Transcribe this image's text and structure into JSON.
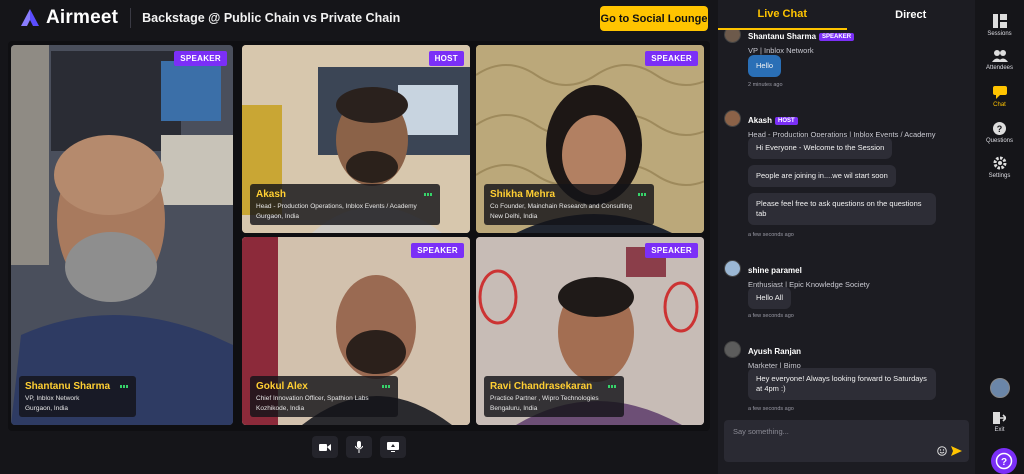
{
  "app": {
    "logo_text": "Airmeet",
    "event_title": "Backstage @ Public Chain vs Private Chain",
    "lounge_button": "Go to Social Lounge"
  },
  "stage": {
    "tiles": [
      {
        "id": "shantanu",
        "badge": "SPEAKER",
        "name": "Shantanu Sharma",
        "role": "VP, Inblox Network",
        "location": "Gurgaon, India",
        "bg": "#3a4258"
      },
      {
        "id": "akash",
        "badge": "HOST",
        "name": "Akash",
        "role": "Head - Production Operations, Inblox Events / Academy",
        "location": "Gurgaon, India",
        "bg": "#c9b59a"
      },
      {
        "id": "shikha",
        "badge": "SPEAKER",
        "name": "Shikha Mehra",
        "role": "Co Founder, Mainchain Research and Consulting",
        "location": "New Delhi, India",
        "bg": "#b39e6e"
      },
      {
        "id": "gokul",
        "badge": "SPEAKER",
        "name": "Gokul Alex",
        "role": "Chief Innovation Officer, Spathion Labs",
        "location": "Kozhikode, India",
        "bg": "#c8b3a0"
      },
      {
        "id": "ravi",
        "badge": "SPEAKER",
        "name": "Ravi Chandrasekaran",
        "role": "Practice Partner , Wipro Technologies",
        "location": "Bengaluru, India",
        "bg": "#b4a8a3"
      }
    ]
  },
  "controls": {
    "items": [
      {
        "name": "camera-button",
        "icon": "video-camera-icon"
      },
      {
        "name": "microphone-button",
        "icon": "microphone-icon"
      },
      {
        "name": "screen-share-button",
        "icon": "screen-share-icon"
      }
    ]
  },
  "chat": {
    "tabs": [
      "Live Chat",
      "Direct"
    ],
    "active_tab": "Live Chat",
    "messages": [
      {
        "author": "Shantanu Sharma",
        "tag": "SPEAKER",
        "title": "VP | Inblox Network",
        "texts": [
          "Hello"
        ],
        "time": "2 minutes ago"
      },
      {
        "author": "Akash",
        "tag": "HOST",
        "title": "Head - Production Operations | Inblox Events / Academy",
        "texts": [
          "Hi Everyone - Welcome to the Session",
          "People are joining in....we wil start soon",
          "Please feel free to ask questions on the questions tab"
        ],
        "time": "a few seconds ago"
      },
      {
        "author": "shine paramel",
        "tag": "",
        "title": "Enthusiast | Epic Knowledge Society",
        "texts": [
          "Hello All"
        ],
        "time": "a few seconds ago"
      },
      {
        "author": "Ayush Ranjan",
        "tag": "",
        "title": "Marketer | Bimo",
        "texts": [
          "Hey everyone! Always looking forward to Saturdays at 4pm :)"
        ],
        "time": "a few seconds ago"
      }
    ],
    "composer_placeholder": "Say something..."
  },
  "rail": {
    "items": [
      {
        "label": "Sessions",
        "icon": "sessions-grid-icon"
      },
      {
        "label": "Attendees",
        "icon": "attendees-icon"
      },
      {
        "label": "Chat",
        "icon": "chat-icon"
      },
      {
        "label": "Questions",
        "icon": "question-icon"
      },
      {
        "label": "Settings",
        "icon": "gear-icon"
      },
      {
        "label": "Exit",
        "icon": "exit-icon"
      }
    ],
    "active": "Chat"
  },
  "colors": {
    "accent": "#ffc400",
    "badge": "#7b2ff7",
    "brand": "#5b4dff"
  }
}
